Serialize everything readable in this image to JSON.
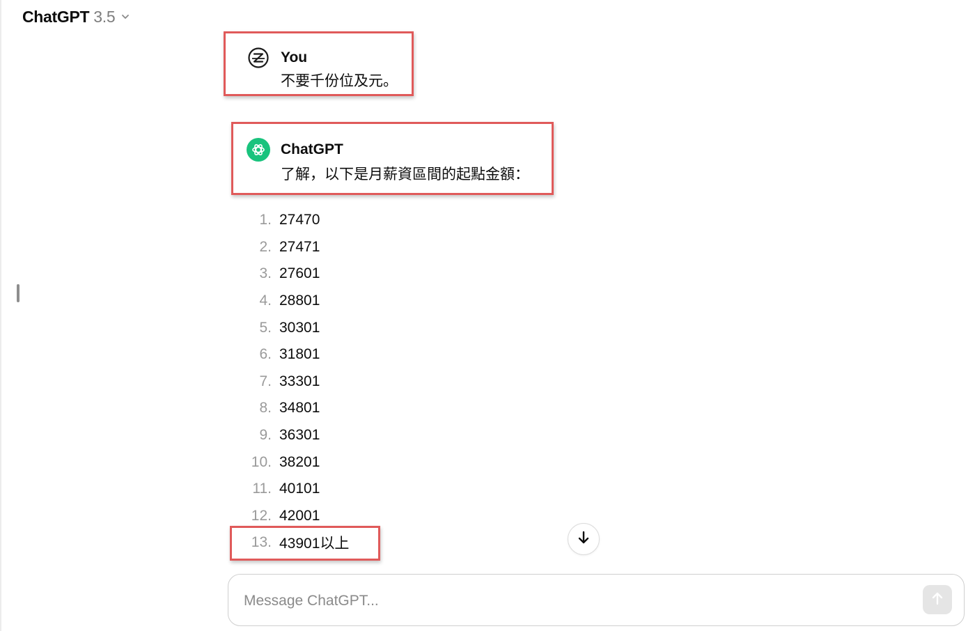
{
  "header": {
    "model_name": "ChatGPT",
    "model_version": "3.5"
  },
  "conversation": {
    "user_message": {
      "author": "You",
      "text": "不要千份位及元。",
      "avatar_icon": "user-z-avatar-icon"
    },
    "assistant_message": {
      "author": "ChatGPT",
      "intro": "了解，以下是月薪資區間的起點金額：",
      "avatar_icon": "openai-logo-icon",
      "avatar_color": "#19c37d",
      "list": [
        {
          "num": "1.",
          "value": "27470"
        },
        {
          "num": "2.",
          "value": "27471"
        },
        {
          "num": "3.",
          "value": "27601"
        },
        {
          "num": "4.",
          "value": "28801"
        },
        {
          "num": "5.",
          "value": "30301"
        },
        {
          "num": "6.",
          "value": "31801"
        },
        {
          "num": "7.",
          "value": "33301"
        },
        {
          "num": "8.",
          "value": "34801"
        },
        {
          "num": "9.",
          "value": "36301"
        },
        {
          "num": "10.",
          "value": "38201"
        },
        {
          "num": "11.",
          "value": "40101"
        },
        {
          "num": "12.",
          "value": "42001"
        },
        {
          "num": "13.",
          "value": "43901以上"
        }
      ]
    }
  },
  "composer": {
    "placeholder": "Message ChatGPT...",
    "value": ""
  },
  "icons": {
    "model_dropdown": "chevron-down-icon",
    "scroll_down": "arrow-down-icon",
    "send": "arrow-up-icon"
  },
  "colors": {
    "highlight_box": "#e05a5a",
    "assistant_avatar": "#19c37d",
    "list_number": "#9a9a9a"
  }
}
